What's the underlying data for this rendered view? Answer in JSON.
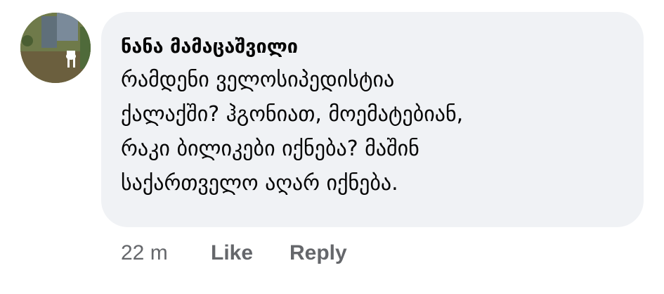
{
  "comment": {
    "author": "ნანა მამაცაშვილი",
    "text_lines": [
      "რამდენი ველოსიპედისტია",
      "ქალაქში? ჰგონიათ, მოემატებიან,",
      "რაკი ბილიკები იქნება? მაშინ",
      "საქართველო აღარ იქნება."
    ],
    "timestamp": "22 m",
    "like_label": "Like",
    "reply_label": "Reply"
  },
  "colors": {
    "bubble_background": "#f0f2f5",
    "text": "#050505",
    "secondary_text": "#65676b"
  },
  "icons": {
    "avatar": "profile-photo"
  }
}
